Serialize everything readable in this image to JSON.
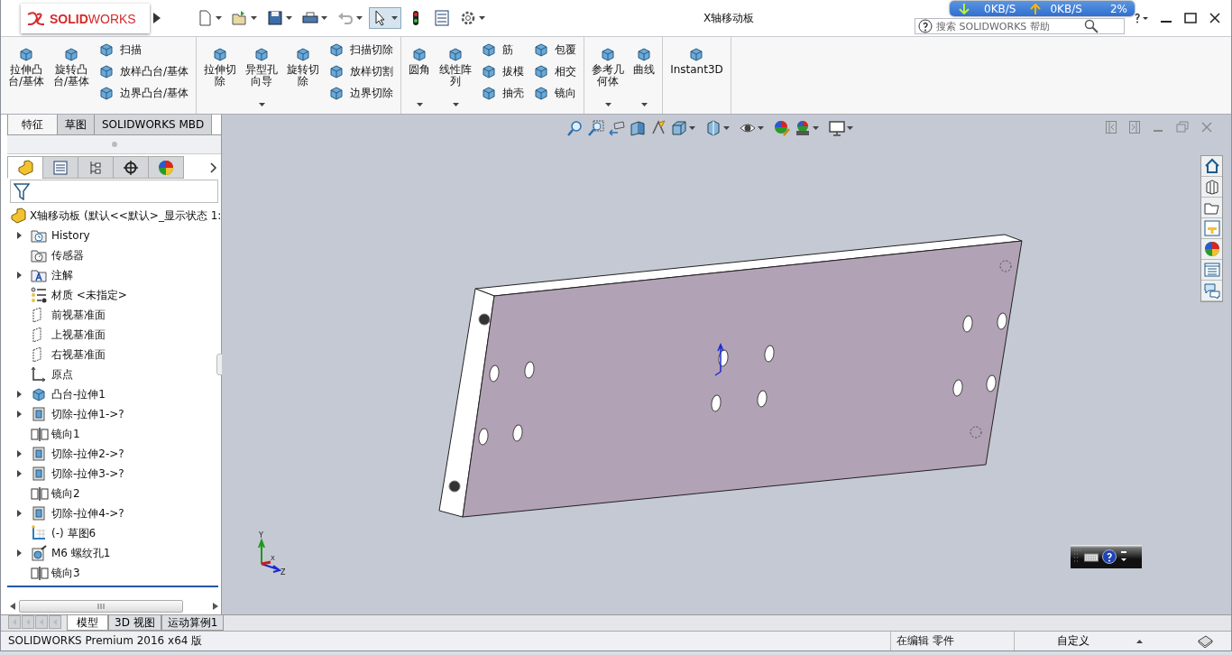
{
  "window": {
    "title": "X轴移动板"
  },
  "app": {
    "logo": "**SOLID**WORKS"
  },
  "search": {
    "placeholder": "搜索 SOLIDWORKS 帮助"
  },
  "network_monitor": {
    "download": "0KB/S",
    "upload": "0KB/S",
    "usage": "2%"
  },
  "ribbon": {
    "groups": [
      {
        "items": [
          {
            "kind": "large",
            "lines": [
              "拉伸凸",
              "台/基体"
            ],
            "dropdown": false
          },
          {
            "kind": "large",
            "lines": [
              "旋转凸",
              "台/基体"
            ],
            "dropdown": false
          },
          {
            "kind": "column",
            "labels": [
              "扫描",
              "放样凸台/基体",
              "边界凸台/基体"
            ]
          }
        ]
      },
      {
        "items": [
          {
            "kind": "large",
            "lines": [
              "拉伸切",
              "除"
            ],
            "dropdown": false
          },
          {
            "kind": "large",
            "lines": [
              "异型孔",
              "向导"
            ],
            "dropdown": true
          },
          {
            "kind": "large",
            "lines": [
              "旋转切",
              "除"
            ],
            "dropdown": false
          },
          {
            "kind": "column",
            "labels": [
              "扫描切除",
              "放样切割",
              "边界切除"
            ]
          }
        ]
      },
      {
        "items": [
          {
            "kind": "large",
            "lines": [
              "圆角"
            ],
            "dropdown": true
          },
          {
            "kind": "large",
            "lines": [
              "线性阵",
              "列"
            ],
            "dropdown": true
          },
          {
            "kind": "column",
            "labels": [
              "筋",
              "拔模",
              "抽壳"
            ]
          },
          {
            "kind": "column",
            "labels": [
              "包覆",
              "相交",
              "镜向"
            ]
          }
        ]
      },
      {
        "items": [
          {
            "kind": "large",
            "lines": [
              "参考几",
              "何体"
            ],
            "dropdown": true
          },
          {
            "kind": "large",
            "lines": [
              "曲线"
            ],
            "dropdown": true
          }
        ]
      },
      {
        "items": [
          {
            "kind": "large",
            "lines": [
              "Instant3D"
            ],
            "dropdown": false
          }
        ]
      }
    ]
  },
  "manager_tabs": [
    {
      "label": "特征",
      "selected": true
    },
    {
      "label": "草图",
      "selected": false
    },
    {
      "label": "SOLIDWORKS MBD",
      "selected": false
    }
  ],
  "panel_tabs": [
    {
      "selected": true
    },
    {
      "selected": false
    },
    {
      "selected": false
    },
    {
      "selected": false
    },
    {
      "selected": false
    }
  ],
  "tree": {
    "label": "X轴移动板  (默认<<默认>_显示状态 1:",
    "children": [
      {
        "label": "History",
        "kind": "history",
        "expandable": true
      },
      {
        "label": "传感器",
        "kind": "sensor",
        "expandable": false
      },
      {
        "label": "注解",
        "kind": "annotation",
        "expandable": true
      },
      {
        "label": "材质 <未指定>",
        "kind": "material",
        "expandable": false
      },
      {
        "label": "前视基准面",
        "kind": "plane",
        "expandable": false
      },
      {
        "label": "上视基准面",
        "kind": "plane",
        "expandable": false
      },
      {
        "label": "右视基准面",
        "kind": "plane",
        "expandable": false
      },
      {
        "label": "原点",
        "kind": "origin",
        "expandable": false
      },
      {
        "label": "凸台-拉伸1",
        "kind": "boss",
        "expandable": true
      },
      {
        "label": "切除-拉伸1->?",
        "kind": "cut",
        "expandable": true
      },
      {
        "label": "镜向1",
        "kind": "mirror",
        "expandable": false
      },
      {
        "label": "切除-拉伸2->?",
        "kind": "cut",
        "expandable": true
      },
      {
        "label": "切除-拉伸3->?",
        "kind": "cut",
        "expandable": true
      },
      {
        "label": "镜向2",
        "kind": "mirror",
        "expandable": false
      },
      {
        "label": "切除-拉伸4->?",
        "kind": "cut",
        "expandable": true
      },
      {
        "label": "(-) 草图6",
        "kind": "sketch",
        "expandable": false
      },
      {
        "label": "M6 螺纹孔1",
        "kind": "hole",
        "expandable": true
      },
      {
        "label": "镜向3",
        "kind": "mirror",
        "expandable": false
      }
    ]
  },
  "triad": {
    "labels": [
      "Y",
      "X",
      "Z"
    ]
  },
  "bottom_tabs": [
    {
      "label": "模型",
      "selected": true
    },
    {
      "label": "3D 视图",
      "selected": false
    },
    {
      "label": "运动算例1",
      "selected": false
    }
  ],
  "status_bar": {
    "product": "SOLIDWORKS Premium 2016 x64 版",
    "mode": "在编辑 零件",
    "units": "自定义"
  }
}
